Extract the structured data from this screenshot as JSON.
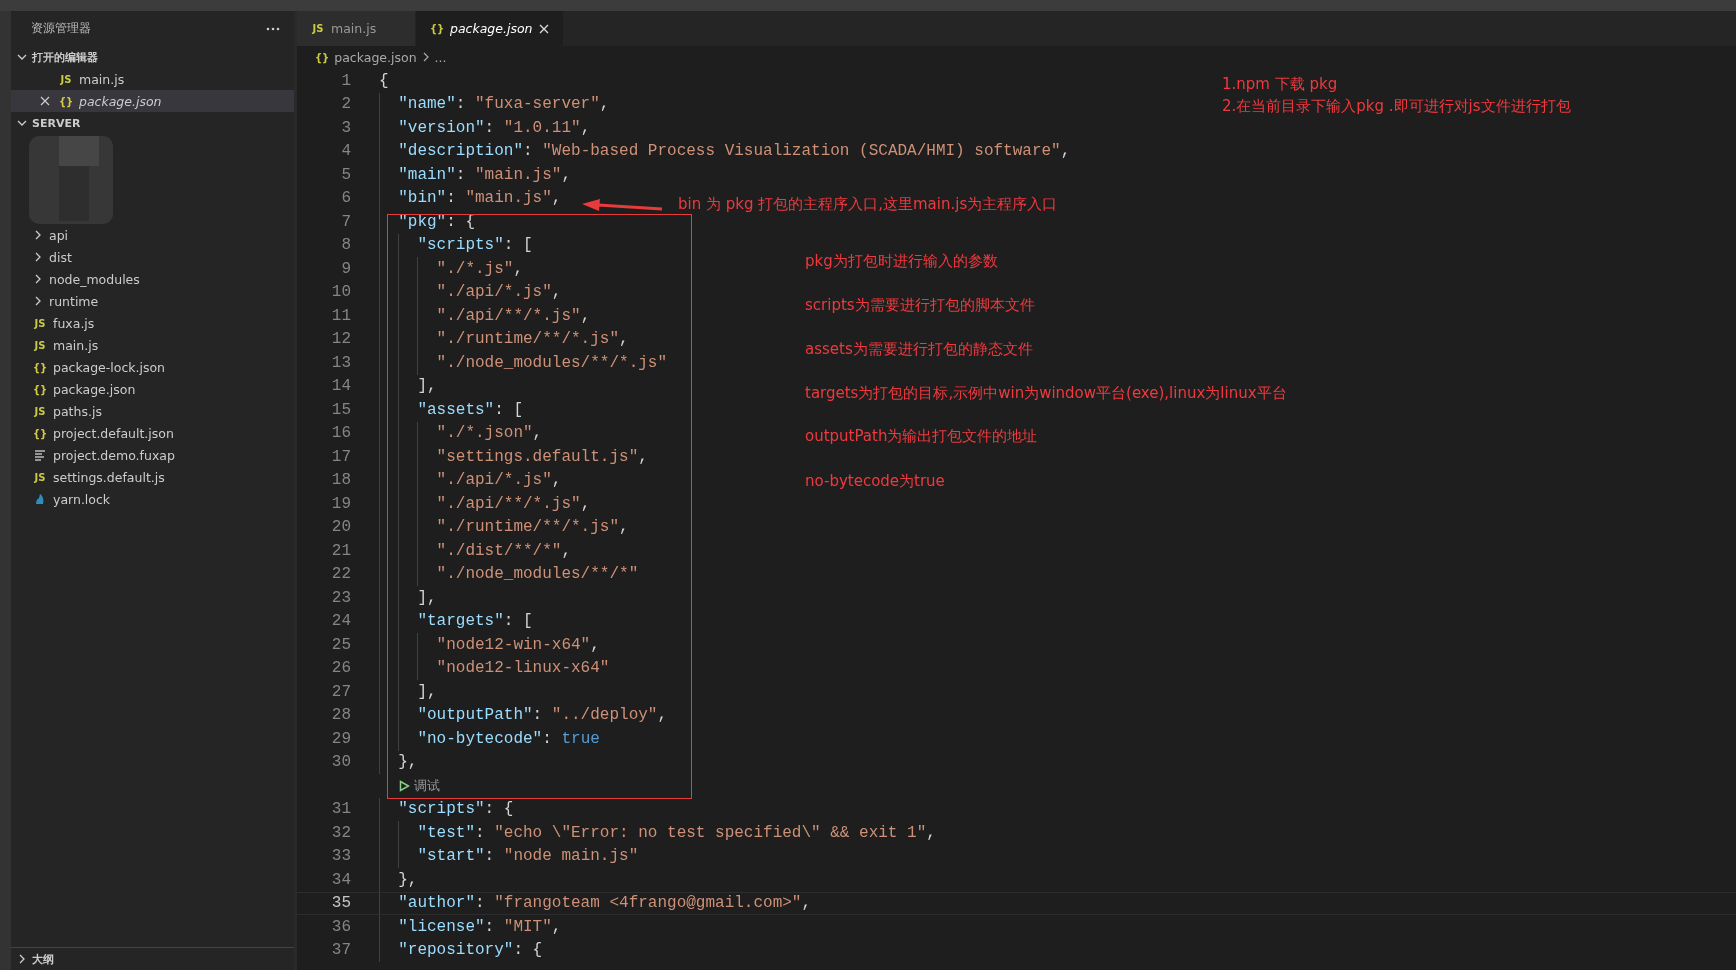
{
  "explorer": {
    "title": "资源管理器",
    "open_editors": {
      "title": "打开的编辑器",
      "expanded": true,
      "items": [
        {
          "label": "main.js",
          "kind": "js",
          "icon": "JS",
          "selected": false,
          "preview": false
        },
        {
          "label": "package.json",
          "kind": "json",
          "icon": "{}",
          "selected": true,
          "preview": true
        }
      ]
    },
    "folder": {
      "title": "SERVER",
      "expanded": true,
      "items": [
        {
          "label": "api",
          "kind": "folder",
          "expanded": false
        },
        {
          "label": "dist",
          "kind": "folder",
          "expanded": false
        },
        {
          "label": "node_modules",
          "kind": "folder",
          "expanded": false
        },
        {
          "label": "runtime",
          "kind": "folder",
          "expanded": false
        },
        {
          "label": "fuxa.js",
          "kind": "js",
          "icon": "JS"
        },
        {
          "label": "main.js",
          "kind": "js",
          "icon": "JS"
        },
        {
          "label": "package-lock.json",
          "kind": "json",
          "icon": "{}"
        },
        {
          "label": "package.json",
          "kind": "json",
          "icon": "{}"
        },
        {
          "label": "paths.js",
          "kind": "js",
          "icon": "JS"
        },
        {
          "label": "project.default.json",
          "kind": "json",
          "icon": "{}"
        },
        {
          "label": "project.demo.fuxap",
          "kind": "text"
        },
        {
          "label": "settings.default.js",
          "kind": "js",
          "icon": "JS"
        },
        {
          "label": "yarn.lock",
          "kind": "yarn"
        }
      ]
    },
    "outline": {
      "title": "大纲",
      "expanded": false
    }
  },
  "tabs": [
    {
      "label": "main.js",
      "icon": "JS",
      "selected": false,
      "preview": false
    },
    {
      "label": "package.json",
      "icon": "{}",
      "selected": true,
      "preview": true
    }
  ],
  "breadcrumb": {
    "icon": "{}",
    "file": "package.json",
    "rest": "..."
  },
  "lines": [
    {
      "kind": "code",
      "n": "1",
      "current": false,
      "tokens": [
        {
          "kind": "p",
          "t": "{"
        }
      ]
    },
    {
      "kind": "code",
      "n": "2",
      "current": false,
      "tokens": [
        {
          "kind": "key",
          "t": "  \"name\""
        },
        {
          "kind": "p",
          "t": ": "
        },
        {
          "kind": "str",
          "t": "\"fuxa-server\""
        },
        {
          "kind": "p",
          "t": ","
        }
      ]
    },
    {
      "kind": "code",
      "n": "3",
      "current": false,
      "tokens": [
        {
          "kind": "key",
          "t": "  \"version\""
        },
        {
          "kind": "p",
          "t": ": "
        },
        {
          "kind": "str",
          "t": "\"1.0.11\""
        },
        {
          "kind": "p",
          "t": ","
        }
      ]
    },
    {
      "kind": "code",
      "n": "4",
      "current": false,
      "tokens": [
        {
          "kind": "key",
          "t": "  \"description\""
        },
        {
          "kind": "p",
          "t": ": "
        },
        {
          "kind": "str",
          "t": "\"Web-based Process Visualization (SCADA/HMI) software\""
        },
        {
          "kind": "p",
          "t": ","
        }
      ]
    },
    {
      "kind": "code",
      "n": "5",
      "current": false,
      "tokens": [
        {
          "kind": "key",
          "t": "  \"main\""
        },
        {
          "kind": "p",
          "t": ": "
        },
        {
          "kind": "str",
          "t": "\"main.js\""
        },
        {
          "kind": "p",
          "t": ","
        }
      ]
    },
    {
      "kind": "code",
      "n": "6",
      "current": false,
      "tokens": [
        {
          "kind": "key",
          "t": "  \"bin\""
        },
        {
          "kind": "p",
          "t": ": "
        },
        {
          "kind": "str",
          "t": "\"main.js\""
        },
        {
          "kind": "p",
          "t": ","
        }
      ]
    },
    {
      "kind": "code",
      "n": "7",
      "current": false,
      "tokens": [
        {
          "kind": "key",
          "t": "  \"pkg\""
        },
        {
          "kind": "p",
          "t": ": {"
        }
      ]
    },
    {
      "kind": "code",
      "n": "8",
      "current": false,
      "tokens": [
        {
          "kind": "key",
          "t": "    \"scripts\""
        },
        {
          "kind": "p",
          "t": ": ["
        }
      ]
    },
    {
      "kind": "code",
      "n": "9",
      "current": false,
      "tokens": [
        {
          "kind": "str",
          "t": "      \"./*.js\""
        },
        {
          "kind": "p",
          "t": ","
        }
      ]
    },
    {
      "kind": "code",
      "n": "10",
      "current": false,
      "tokens": [
        {
          "kind": "str",
          "t": "      \"./api/*.js\""
        },
        {
          "kind": "p",
          "t": ","
        }
      ]
    },
    {
      "kind": "code",
      "n": "11",
      "current": false,
      "tokens": [
        {
          "kind": "str",
          "t": "      \"./api/**/*.js\""
        },
        {
          "kind": "p",
          "t": ","
        }
      ]
    },
    {
      "kind": "code",
      "n": "12",
      "current": false,
      "tokens": [
        {
          "kind": "str",
          "t": "      \"./runtime/**/*.js\""
        },
        {
          "kind": "p",
          "t": ","
        }
      ]
    },
    {
      "kind": "code",
      "n": "13",
      "current": false,
      "tokens": [
        {
          "kind": "str",
          "t": "      \"./node_modules/**/*.js\""
        }
      ]
    },
    {
      "kind": "code",
      "n": "14",
      "current": false,
      "tokens": [
        {
          "kind": "p",
          "t": "    ],"
        }
      ]
    },
    {
      "kind": "code",
      "n": "15",
      "current": false,
      "tokens": [
        {
          "kind": "key",
          "t": "    \"assets\""
        },
        {
          "kind": "p",
          "t": ": ["
        }
      ]
    },
    {
      "kind": "code",
      "n": "16",
      "current": false,
      "tokens": [
        {
          "kind": "str",
          "t": "      \"./*.json\""
        },
        {
          "kind": "p",
          "t": ","
        }
      ]
    },
    {
      "kind": "code",
      "n": "17",
      "current": false,
      "tokens": [
        {
          "kind": "str",
          "t": "      \"settings.default.js\""
        },
        {
          "kind": "p",
          "t": ","
        }
      ]
    },
    {
      "kind": "code",
      "n": "18",
      "current": false,
      "tokens": [
        {
          "kind": "str",
          "t": "      \"./api/*.js\""
        },
        {
          "kind": "p",
          "t": ","
        }
      ]
    },
    {
      "kind": "code",
      "n": "19",
      "current": false,
      "tokens": [
        {
          "kind": "str",
          "t": "      \"./api/**/*.js\""
        },
        {
          "kind": "p",
          "t": ","
        }
      ]
    },
    {
      "kind": "code",
      "n": "20",
      "current": false,
      "tokens": [
        {
          "kind": "str",
          "t": "      \"./runtime/**/*.js\""
        },
        {
          "kind": "p",
          "t": ","
        }
      ]
    },
    {
      "kind": "code",
      "n": "21",
      "current": false,
      "tokens": [
        {
          "kind": "str",
          "t": "      \"./dist/**/*\""
        },
        {
          "kind": "p",
          "t": ","
        }
      ]
    },
    {
      "kind": "code",
      "n": "22",
      "current": false,
      "tokens": [
        {
          "kind": "str",
          "t": "      \"./node_modules/**/*\""
        }
      ]
    },
    {
      "kind": "code",
      "n": "23",
      "current": false,
      "tokens": [
        {
          "kind": "p",
          "t": "    ],"
        }
      ]
    },
    {
      "kind": "code",
      "n": "24",
      "current": false,
      "tokens": [
        {
          "kind": "key",
          "t": "    \"targets\""
        },
        {
          "kind": "p",
          "t": ": ["
        }
      ]
    },
    {
      "kind": "code",
      "n": "25",
      "current": false,
      "tokens": [
        {
          "kind": "str",
          "t": "      \"node12-win-x64\""
        },
        {
          "kind": "p",
          "t": ","
        }
      ]
    },
    {
      "kind": "code",
      "n": "26",
      "current": false,
      "tokens": [
        {
          "kind": "str",
          "t": "      \"node12-linux-x64\""
        }
      ]
    },
    {
      "kind": "code",
      "n": "27",
      "current": false,
      "tokens": [
        {
          "kind": "p",
          "t": "    ],"
        }
      ]
    },
    {
      "kind": "code",
      "n": "28",
      "current": false,
      "tokens": [
        {
          "kind": "key",
          "t": "    \"outputPath\""
        },
        {
          "kind": "p",
          "t": ": "
        },
        {
          "kind": "str",
          "t": "\"../deploy\""
        },
        {
          "kind": "p",
          "t": ","
        }
      ]
    },
    {
      "kind": "code",
      "n": "29",
      "current": false,
      "tokens": [
        {
          "kind": "key",
          "t": "    \"no-bytecode\""
        },
        {
          "kind": "p",
          "t": ": "
        },
        {
          "kind": "bool",
          "t": "true"
        }
      ]
    },
    {
      "kind": "code",
      "n": "30",
      "current": false,
      "tokens": [
        {
          "kind": "p",
          "t": "  },"
        }
      ]
    },
    {
      "kind": "codelens",
      "label": "调试"
    },
    {
      "kind": "code",
      "n": "31",
      "current": false,
      "tokens": [
        {
          "kind": "key",
          "t": "  \"scripts\""
        },
        {
          "kind": "p",
          "t": ": {"
        }
      ]
    },
    {
      "kind": "code",
      "n": "32",
      "current": false,
      "tokens": [
        {
          "kind": "key",
          "t": "    \"test\""
        },
        {
          "kind": "p",
          "t": ": "
        },
        {
          "kind": "str",
          "t": "\"echo \\\"Error: no test specified\\\" && exit 1\""
        },
        {
          "kind": "p",
          "t": ","
        }
      ]
    },
    {
      "kind": "code",
      "n": "33",
      "current": false,
      "tokens": [
        {
          "kind": "key",
          "t": "    \"start\""
        },
        {
          "kind": "p",
          "t": ": "
        },
        {
          "kind": "str",
          "t": "\"node main.js\""
        }
      ]
    },
    {
      "kind": "code",
      "n": "34",
      "current": false,
      "tokens": [
        {
          "kind": "p",
          "t": "  },"
        }
      ]
    },
    {
      "kind": "code",
      "n": "35",
      "current": true,
      "tokens": [
        {
          "kind": "key",
          "t": "  \"author\""
        },
        {
          "kind": "p",
          "t": ": "
        },
        {
          "kind": "str",
          "t": "\"frangoteam <4frango@gmail.com>\""
        },
        {
          "kind": "p",
          "t": ","
        }
      ]
    },
    {
      "kind": "code",
      "n": "36",
      "current": false,
      "tokens": [
        {
          "kind": "key",
          "t": "  \"license\""
        },
        {
          "kind": "p",
          "t": ": "
        },
        {
          "kind": "str",
          "t": "\"MIT\""
        },
        {
          "kind": "p",
          "t": ","
        }
      ]
    },
    {
      "kind": "code",
      "n": "37",
      "current": false,
      "tokens": [
        {
          "kind": "key",
          "t": "  \"repository\""
        },
        {
          "kind": "p",
          "t": ": {"
        }
      ]
    }
  ],
  "annotations": [
    {
      "text": "1.npm 下载 pkg"
    },
    {
      "text": "2.在当前目录下输入pkg .即可进行对js文件进行打包"
    },
    {
      "text": "bin 为 pkg 打包的主程序入口,这里main.js为主程序入口"
    },
    {
      "text": "pkg为打包时进行输入的参数"
    },
    {
      "text": "scripts为需要进行打包的脚本文件"
    },
    {
      "text": "assets为需要进行打包的静态文件"
    },
    {
      "text": "targets为打包的目标,示例中win为window平台(exe),linux为linux平台"
    },
    {
      "text": "outputPath为输出打包文件的地址"
    },
    {
      "text": "no-bytecode为true"
    }
  ]
}
